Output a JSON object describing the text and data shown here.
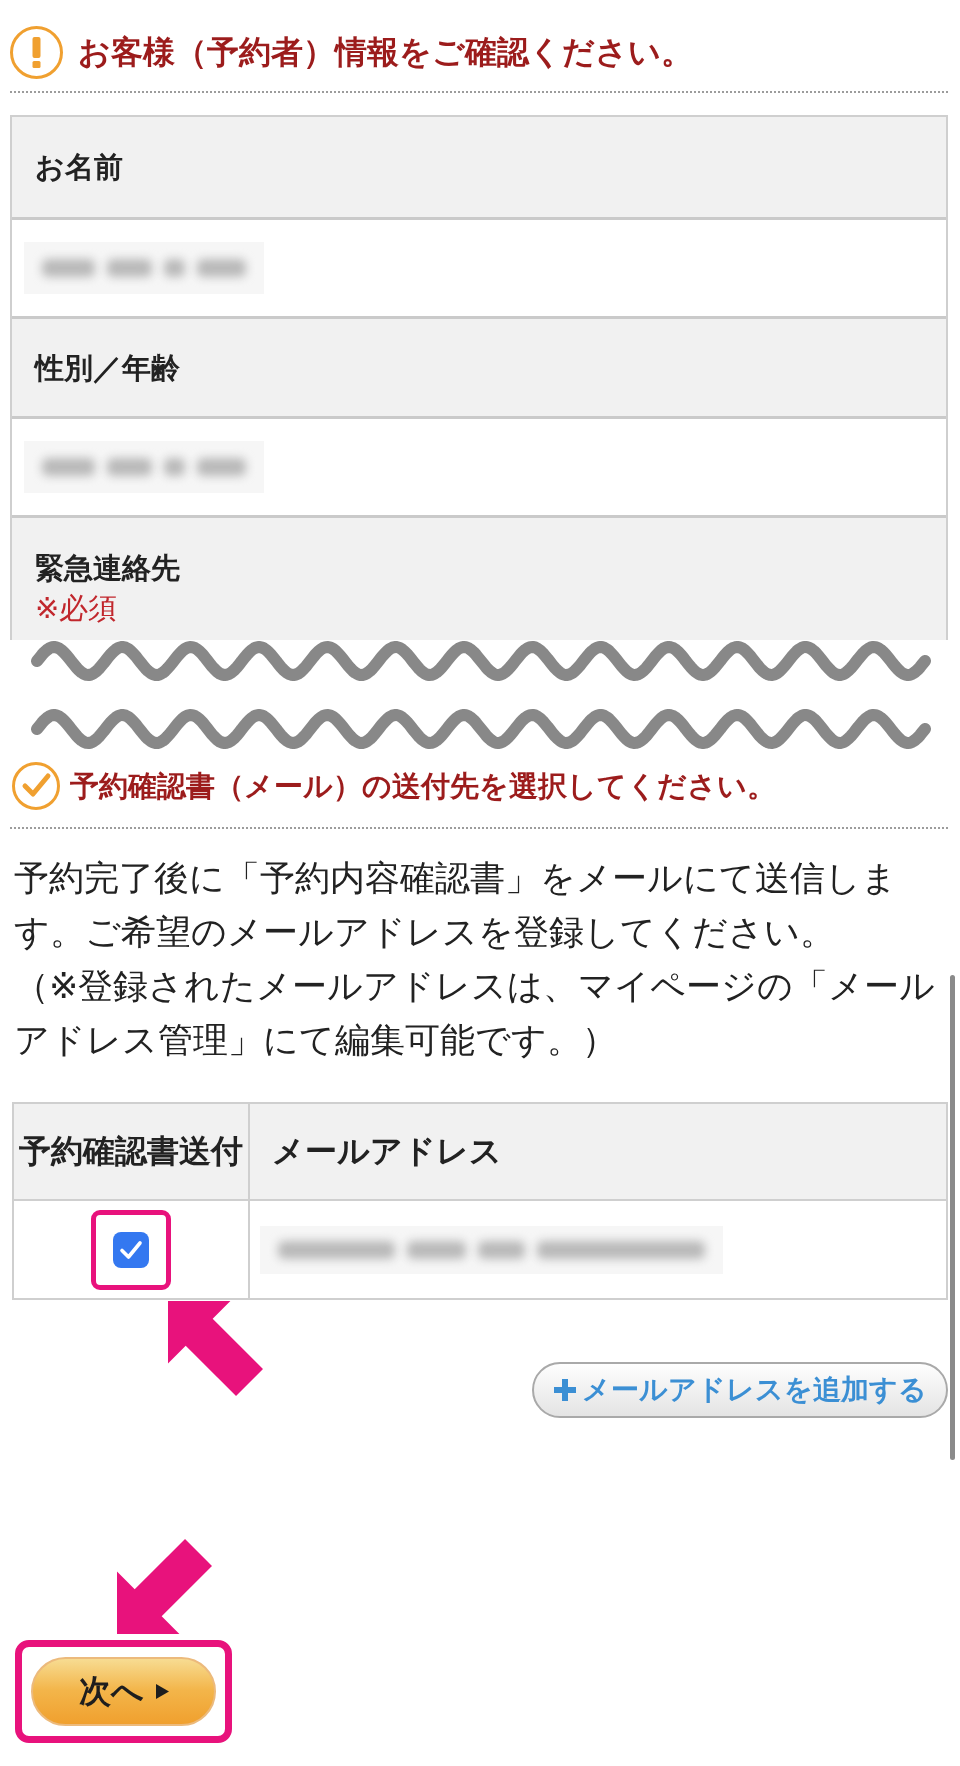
{
  "sections": [
    {
      "kind": "alert",
      "title": "お客様（予約者）情報をご確認ください。",
      "rows": [
        {
          "kind": "heading",
          "label": "お名前"
        },
        {
          "kind": "blurred"
        },
        {
          "kind": "heading",
          "label": "性別／年齢"
        },
        {
          "kind": "blurred"
        },
        {
          "kind": "heading",
          "label": "緊急連絡先",
          "note": "※必須"
        }
      ],
      "truncated": true
    },
    {
      "kind": "check",
      "title": "予約確認書（メール）の送付先を選択してください。",
      "paragraphs": [
        "予約完了後に「予約内容確認書」をメールにて送信します。ご希望のメールアドレスを登録してください。",
        "（※登録されたメールアドレスは、マイページの「メールアドレス管理」にて編集可能です。）"
      ],
      "email_table": {
        "columns": [
          "予約確認書送付",
          "メールアドレス"
        ],
        "rows": [
          {
            "checked": true,
            "highlighted": true
          }
        ]
      },
      "add_button": {
        "label": "メールアドレスを追加する"
      }
    }
  ],
  "next_button": {
    "label": "次へ",
    "highlighted": true
  }
}
